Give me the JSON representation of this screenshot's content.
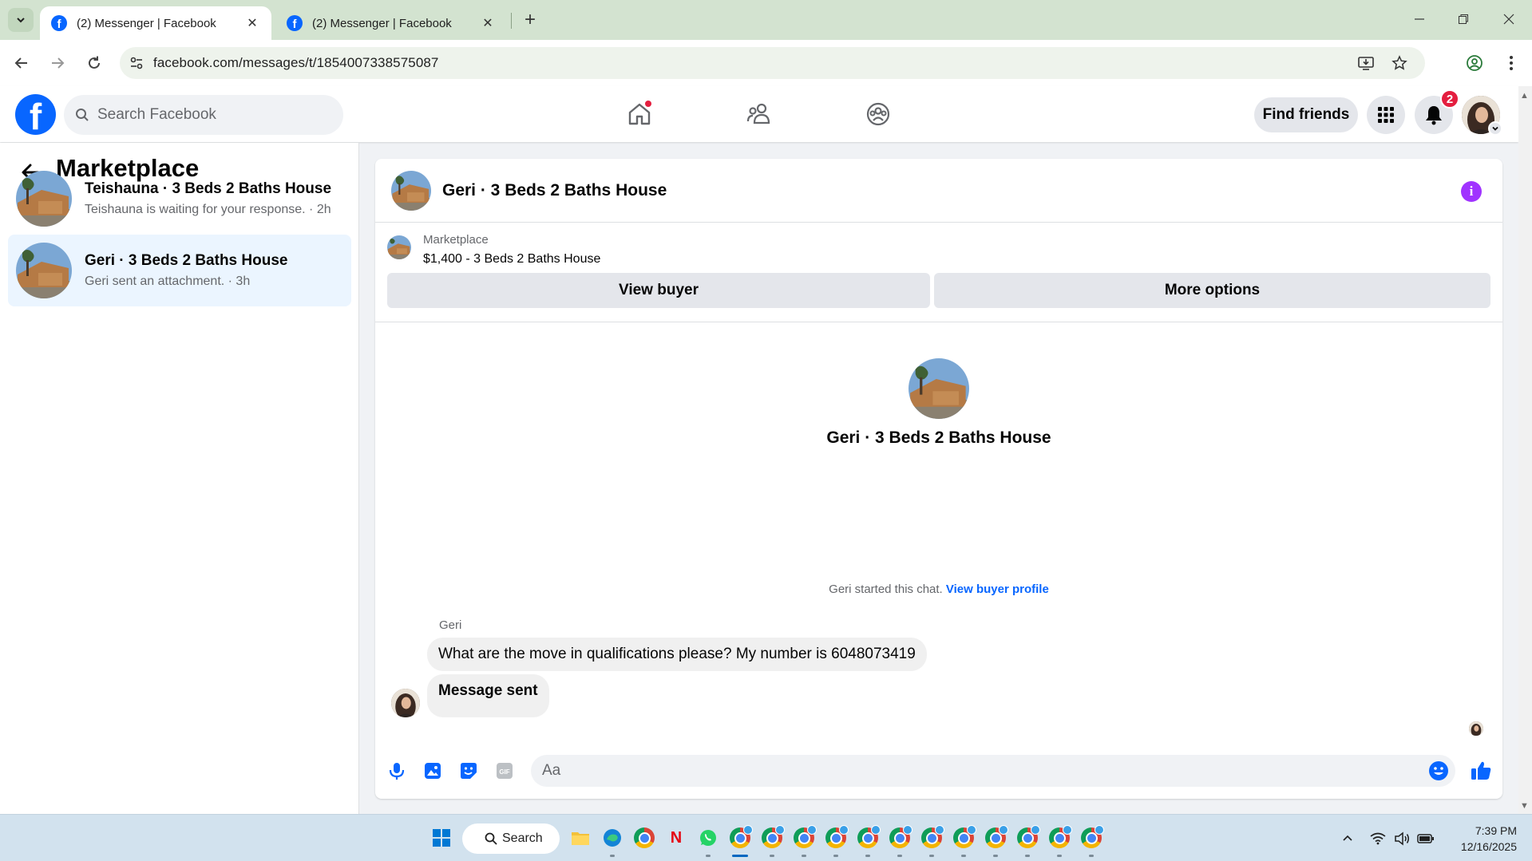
{
  "browser": {
    "tabs": [
      {
        "title": "(2) Messenger | Facebook",
        "active": true
      },
      {
        "title": "(2) Messenger | Facebook",
        "active": false
      }
    ],
    "url": "facebook.com/messages/t/1854007338575087"
  },
  "fb_header": {
    "search_placeholder": "Search Facebook",
    "find_friends_label": "Find friends",
    "notification_count": "2"
  },
  "sidebar": {
    "title": "Marketplace",
    "conversations": [
      {
        "name": "Teishauna · 3 Beds 2 Baths House",
        "preview": "Teishauna is waiting for your response. · 2h",
        "selected": false
      },
      {
        "name": "Geri · 3 Beds 2 Baths House",
        "preview": "Geri sent an attachment. · 3h",
        "selected": true
      }
    ]
  },
  "chat": {
    "title": "Geri · 3 Beds 2 Baths House",
    "listing": {
      "kind": "Marketplace",
      "price_title": "$1,400 - 3 Beds 2 Baths House",
      "view_buyer_label": "View buyer",
      "more_options_label": "More options"
    },
    "intro_name": "Geri · 3 Beds 2 Baths House",
    "started_text": "Geri started this chat.",
    "view_buyer_profile_label": "View buyer profile",
    "sender_name": "Geri",
    "messages": [
      {
        "text": "What are the move in qualifications please? My number is 6048073419"
      },
      {
        "text": "Message sent"
      }
    ],
    "composer_placeholder": "Aa"
  },
  "taskbar": {
    "search_label": "Search",
    "time": "7:39 PM",
    "date": "12/16/2025"
  },
  "colors": {
    "facebook_blue": "#0866ff",
    "info_purple": "#a033ff",
    "badge_red": "#e41e3f",
    "selected_conversation": "#ebf5ff"
  }
}
